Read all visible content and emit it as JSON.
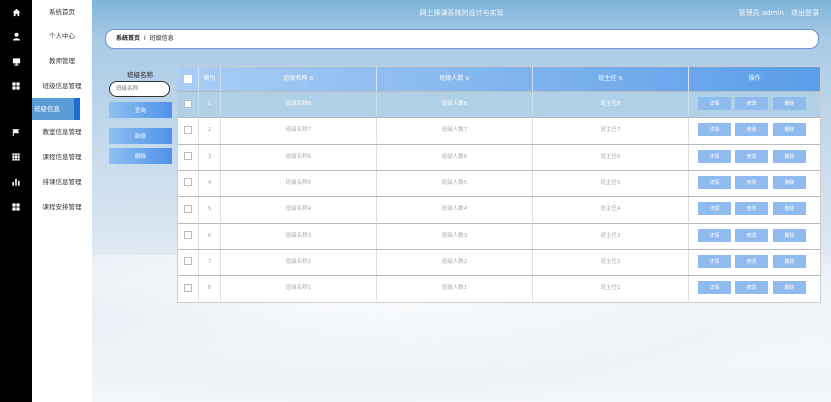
{
  "header": {
    "title": "网上排课系统的设计与实现",
    "role": "管理员 admin",
    "logout": "退出登录"
  },
  "nav": [
    {
      "icon": "home-icon",
      "label": "系统首页"
    },
    {
      "icon": "user-icon",
      "label": "个人中心"
    },
    {
      "icon": "monitor-icon",
      "label": "教师管理"
    },
    {
      "icon": "grid-icon",
      "label": "班级信息管理"
    },
    {
      "icon": "flag-icon",
      "label": "教室信息管理"
    },
    {
      "icon": "grid-icon",
      "label": "课程信息管理"
    },
    {
      "icon": "bar-chart-icon",
      "label": "排课信息管理"
    },
    {
      "icon": "grid-icon",
      "label": "课程安排管理"
    }
  ],
  "sub_nav": {
    "label": "班级信息"
  },
  "breadcrumb": {
    "home": "系统首页",
    "sep": "Ⅰ",
    "current": "班级信息"
  },
  "search": {
    "label": "班级名称",
    "placeholder": "班级名称",
    "query_btn": "查询",
    "add_btn": "新增",
    "delete_btn": "删除"
  },
  "table": {
    "headers": [
      "索引",
      "班级名称",
      "班级人数",
      "班主任",
      "操作"
    ],
    "sort_glyph": "⇅",
    "rows": [
      {
        "index": "1",
        "name": "班级名称8",
        "count": "班级人数8",
        "teacher": "班主任8"
      },
      {
        "index": "2",
        "name": "班级名称7",
        "count": "班级人数7",
        "teacher": "班主任7"
      },
      {
        "index": "3",
        "name": "班级名称6",
        "count": "班级人数6",
        "teacher": "班主任6"
      },
      {
        "index": "4",
        "name": "班级名称5",
        "count": "班级人数5",
        "teacher": "班主任5"
      },
      {
        "index": "5",
        "name": "班级名称4",
        "count": "班级人数4",
        "teacher": "班主任4"
      },
      {
        "index": "6",
        "name": "班级名称3",
        "count": "班级人数3",
        "teacher": "班主任3"
      },
      {
        "index": "7",
        "name": "班级名称2",
        "count": "班级人数2",
        "teacher": "班主任2"
      },
      {
        "index": "8",
        "name": "班级名称1",
        "count": "班级人数1",
        "teacher": "班主任1"
      }
    ],
    "actions": {
      "detail": "详情",
      "edit": "修改",
      "delete": "删除"
    }
  },
  "colors": {
    "accent": "#5b9bd5",
    "header_grad_end": "#5b9de9",
    "button": "#8fbaed"
  }
}
